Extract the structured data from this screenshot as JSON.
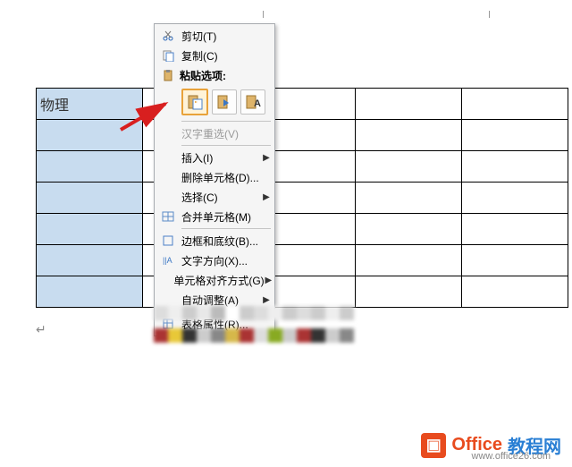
{
  "table": {
    "header_cell": "物理",
    "rows": 7,
    "cols": 5
  },
  "menu": {
    "cut": "剪切(T)",
    "copy": "复制(C)",
    "paste_header": "粘贴选项:",
    "hanzi": "汉字重选(V)",
    "insert": "插入(I)",
    "delete_cells": "删除单元格(D)...",
    "select": "选择(C)",
    "merge_cells": "合并单元格(M)",
    "borders": "边框和底纹(B)...",
    "text_direction": "文字方向(X)...",
    "cell_align": "单元格对齐方式(G)",
    "autofit": "自动调整(A)",
    "table_props": "表格属性(R)..."
  },
  "paste_options": {
    "opt1": "keep-source-formatting",
    "opt2": "merge-formatting",
    "opt3": "text-only"
  },
  "footer": {
    "brand1": "Office",
    "brand2": "教程网",
    "url": "www.office26.com"
  },
  "icons": {
    "scissors": "scissors-icon",
    "copy": "copy-icon",
    "clipboard": "clipboard-icon",
    "merge": "merge-cells-icon",
    "borders": "borders-icon",
    "direction": "text-direction-icon",
    "table": "table-icon"
  }
}
